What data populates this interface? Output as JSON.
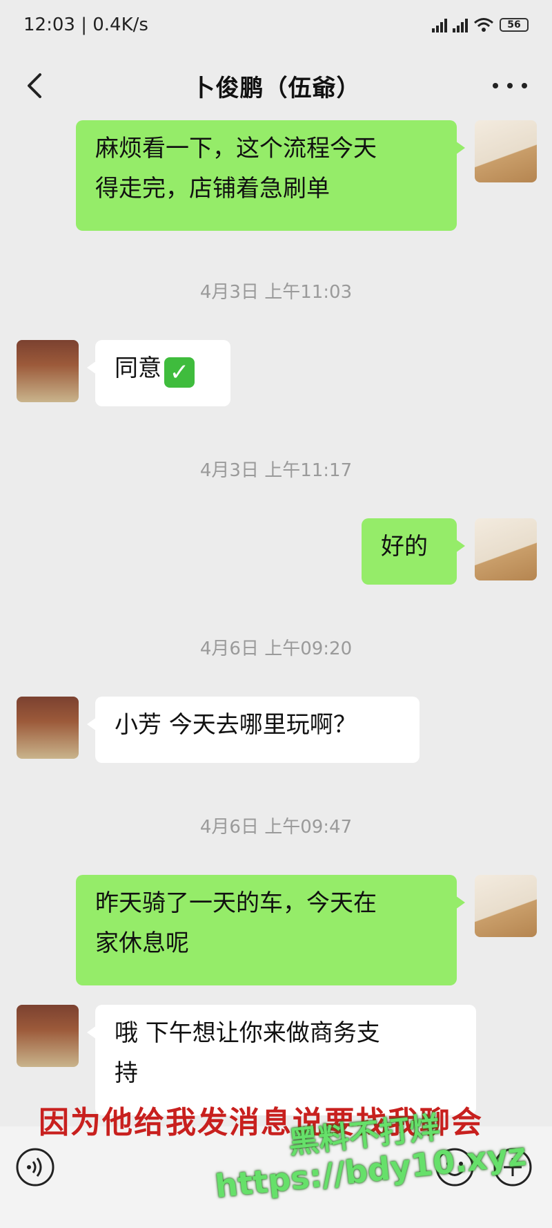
{
  "status_bar": {
    "time": "12:03",
    "net_speed": "0.4K/s",
    "battery": "56"
  },
  "header": {
    "title": "卜俊鹏（伍爺）"
  },
  "messages": [
    {
      "side": "right",
      "text_lines": [
        "麻烦看一下，这个流程今天",
        "得走完，店铺着急刷单"
      ]
    },
    {
      "timestamp": "4月3日 上午11:03"
    },
    {
      "side": "left",
      "text": "同意",
      "emoji": "✅"
    },
    {
      "timestamp": "4月3日 上午11:17"
    },
    {
      "side": "right",
      "text": "好的"
    },
    {
      "timestamp": "4月6日 上午09:20"
    },
    {
      "side": "left",
      "text": "小芳 今天去哪里玩啊？"
    },
    {
      "timestamp": "4月6日 上午09:47"
    },
    {
      "side": "right",
      "text_lines": [
        "昨天骑了一天的车，今天在",
        "家休息呢"
      ]
    },
    {
      "side": "left",
      "text_lines": [
        "哦 下午想让你来做商务支",
        "持"
      ]
    }
  ],
  "caption": "因为他给我发消息说要找我聊会",
  "watermark": {
    "line1": "黑料不打烊",
    "line2": "https://bdy10.xyz"
  },
  "icons": {
    "back": "back-arrow-icon",
    "more": "more-dots-icon",
    "voice": "voice-icon",
    "emoji": "emoji-icon",
    "plus": "plus-icon",
    "wifi": "wifi-icon",
    "signal": "signal-icon"
  }
}
